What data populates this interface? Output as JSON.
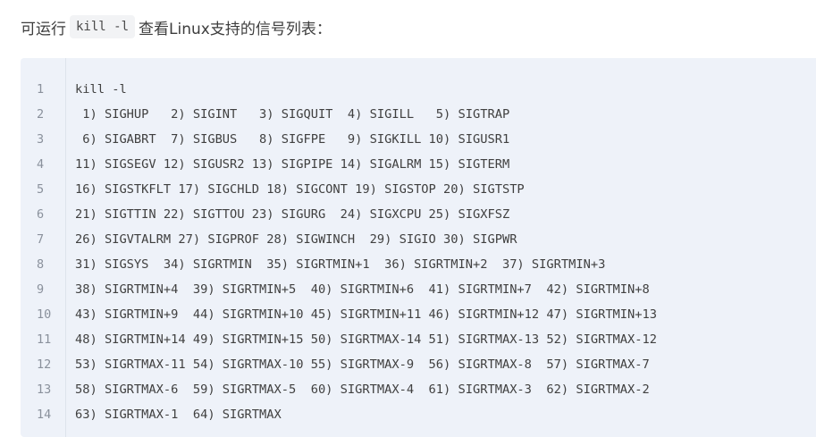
{
  "intro": {
    "prefix": "可运行",
    "inline_code": "kill -l",
    "suffix": "查看Linux支持的信号列表："
  },
  "code_block": {
    "lines": [
      {
        "num": "1",
        "text": "kill -l"
      },
      {
        "num": "2",
        "text": " 1) SIGHUP   2) SIGINT   3) SIGQUIT  4) SIGILL   5) SIGTRAP"
      },
      {
        "num": "3",
        "text": " 6) SIGABRT  7) SIGBUS   8) SIGFPE   9) SIGKILL 10) SIGUSR1"
      },
      {
        "num": "4",
        "text": "11) SIGSEGV 12) SIGUSR2 13) SIGPIPE 14) SIGALRM 15) SIGTERM"
      },
      {
        "num": "5",
        "text": "16) SIGSTKFLT 17) SIGCHLD 18) SIGCONT 19) SIGSTOP 20) SIGTSTP"
      },
      {
        "num": "6",
        "text": "21) SIGTTIN 22) SIGTTOU 23) SIGURG  24) SIGXCPU 25) SIGXFSZ"
      },
      {
        "num": "7",
        "text": "26) SIGVTALRM 27) SIGPROF 28) SIGWINCH  29) SIGIO 30) SIGPWR"
      },
      {
        "num": "8",
        "text": "31) SIGSYS  34) SIGRTMIN  35) SIGRTMIN+1  36) SIGRTMIN+2  37) SIGRTMIN+3"
      },
      {
        "num": "9",
        "text": "38) SIGRTMIN+4  39) SIGRTMIN+5  40) SIGRTMIN+6  41) SIGRTMIN+7  42) SIGRTMIN+8"
      },
      {
        "num": "10",
        "text": "43) SIGRTMIN+9  44) SIGRTMIN+10 45) SIGRTMIN+11 46) SIGRTMIN+12 47) SIGRTMIN+13"
      },
      {
        "num": "11",
        "text": "48) SIGRTMIN+14 49) SIGRTMIN+15 50) SIGRTMAX-14 51) SIGRTMAX-13 52) SIGRTMAX-12"
      },
      {
        "num": "12",
        "text": "53) SIGRTMAX-11 54) SIGRTMAX-10 55) SIGRTMAX-9  56) SIGRTMAX-8  57) SIGRTMAX-7"
      },
      {
        "num": "13",
        "text": "58) SIGRTMAX-6  59) SIGRTMAX-5  60) SIGRTMAX-4  61) SIGRTMAX-3  62) SIGRTMAX-2"
      },
      {
        "num": "14",
        "text": "63) SIGRTMAX-1  64) SIGRTMAX"
      }
    ]
  }
}
